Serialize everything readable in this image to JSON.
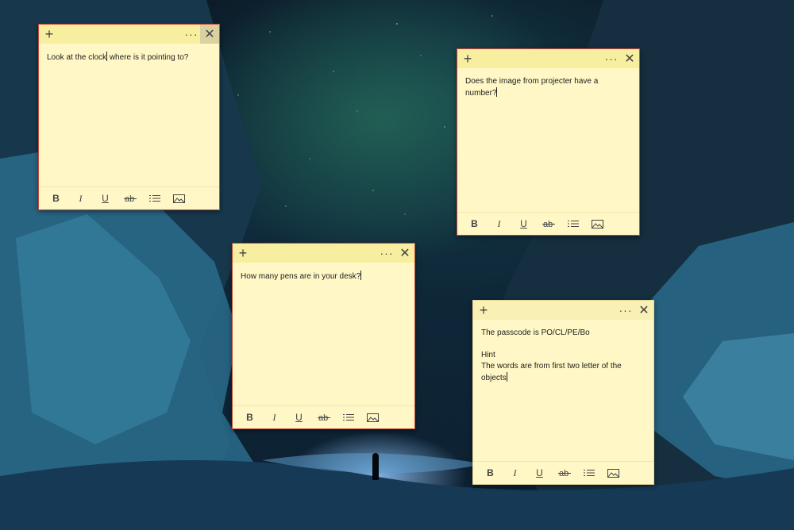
{
  "colors": {
    "note_bg": "#fff7c5",
    "note_header": "#f7eea0",
    "active_border": "#c44a3a",
    "text": "#1e1e1e"
  },
  "notes": [
    {
      "text_before_caret": "Look at the clock",
      "text_after_caret": " where is it pointing to?",
      "active": true
    },
    {
      "text_before_caret": "Does the image from projecter have a number?",
      "text_after_caret": "",
      "active": true
    },
    {
      "text_before_caret": "How many pens are in your desk?",
      "text_after_caret": "",
      "active": true
    },
    {
      "text_before_caret": "The passcode is PO/CL/PE/Bo\n\nHint\nThe words are from first two letter of the objects",
      "text_after_caret": "",
      "active": false
    }
  ],
  "header": {
    "add_icon": "+",
    "menu_icon": "···",
    "close_icon": "✕"
  },
  "toolbar": {
    "bold": "B",
    "italic": "I",
    "underline": "U",
    "strikethrough": "ab",
    "list_icon": "list-icon",
    "image_icon": "image-icon"
  }
}
